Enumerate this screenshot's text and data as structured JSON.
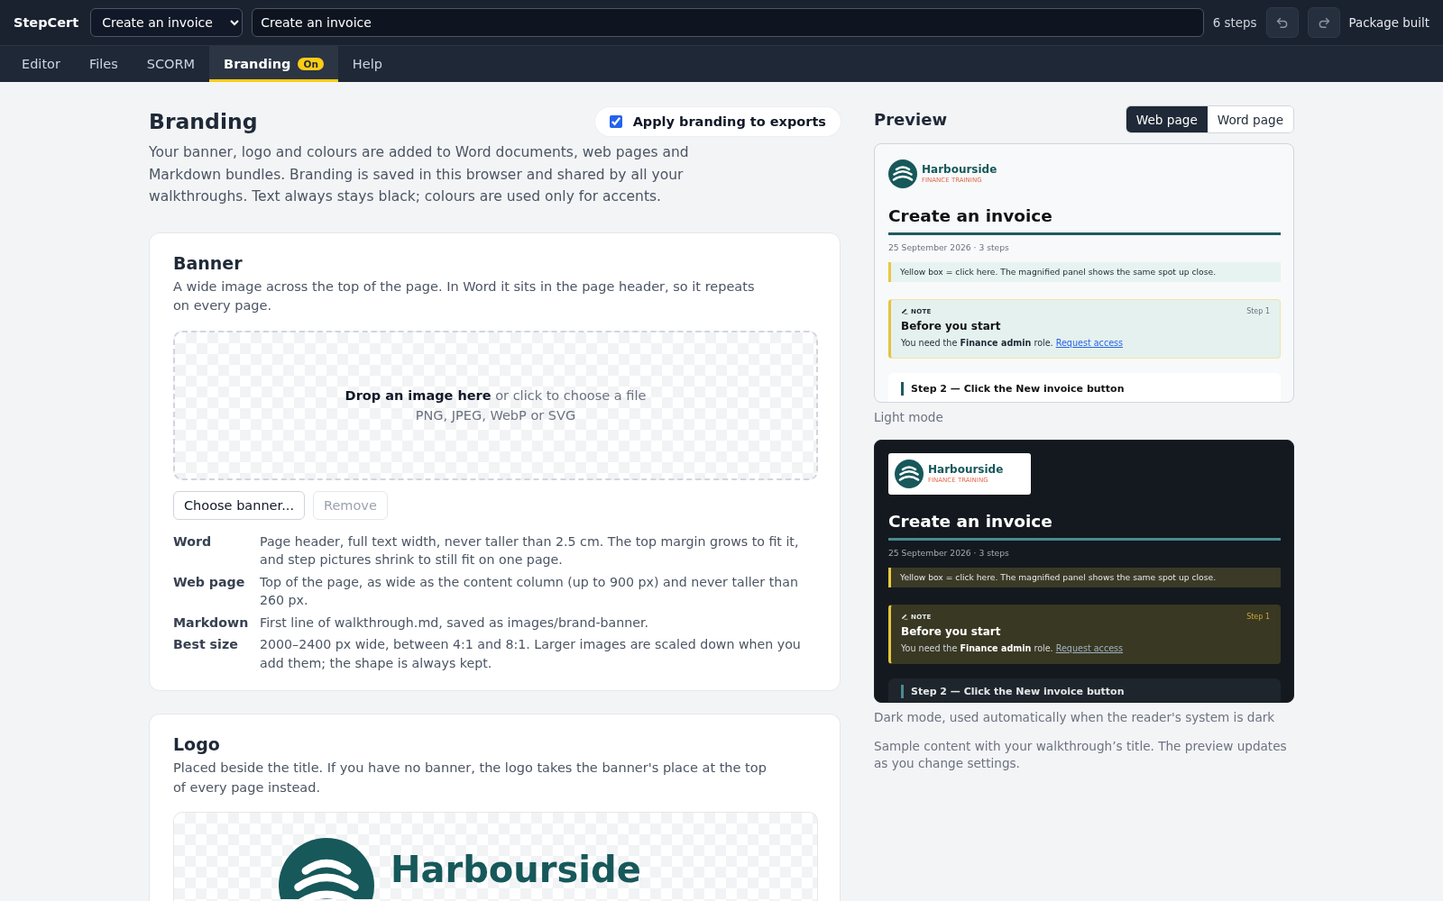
{
  "app": {
    "name": "StepCert"
  },
  "toolbar": {
    "walkthrough": "Create an invoice",
    "title": "Create an invoice",
    "step_count": "6 steps",
    "status": "Package built"
  },
  "tabs": [
    {
      "label": "Editor",
      "selected": false
    },
    {
      "label": "Files",
      "selected": false
    },
    {
      "label": "SCORM",
      "selected": false
    },
    {
      "label": "Branding",
      "selected": true,
      "badge": "On"
    },
    {
      "label": "Help",
      "selected": false
    }
  ],
  "branding": {
    "title": "Branding",
    "apply": {
      "label": "Apply branding to exports",
      "checked": true
    },
    "description": "Your banner, logo and colours are added to Word documents, web pages and Markdown bundles. Branding is saved in this browser and shared by all your walkthroughs. Text always stays black; colours are used only for accents."
  },
  "sections": [
    {
      "title": "Banner",
      "description": "A wide image across the top of the page. In Word it sits in the page header, so it repeats on every page.",
      "dropzone": {
        "prompt": "**Drop an image here** or click to choose a file",
        "formats": "PNG, JPEG, WebP or SVG"
      },
      "buttons": [
        {
          "label": "Choose banner...",
          "disabled": false
        },
        {
          "label": "Remove",
          "disabled": true
        }
      ],
      "details": [
        {
          "term": "Word",
          "text": "Page header, full text width, never taller than 2.5 cm. The top margin grows to fit it, and step pictures shrink to still fit on one page."
        },
        {
          "term": "Web page",
          "text": "Top of the page, as wide as the content column (up to 900 px) and never taller than 260 px."
        },
        {
          "term": "Markdown",
          "text": "First line of walkthrough.md, saved as images/brand-banner."
        },
        {
          "term": "Best size",
          "text": "2000–2400 px wide, between 4:1 and 8:1. Larger images are scaled down when you add them; the shape is always kept."
        }
      ]
    },
    {
      "title": "Logo",
      "description": "Placed beside the title. If you have no banner, the logo takes the banner's place at the top of every page instead.",
      "dropzone": {
        "logo": {
          "name": "Harbourside"
        }
      }
    }
  ],
  "preview": {
    "title": "Preview",
    "modes": [
      {
        "label": "Web page",
        "selected": true
      },
      {
        "label": "Word page",
        "selected": false
      }
    ],
    "samples": [
      {
        "kind": "light",
        "logo": {
          "name": "Harbourside",
          "tagline": "FINANCE TRAINING"
        },
        "title": "Create an invoice",
        "meta": "25 September 2026 · 3 steps",
        "hint": "Yellow box = click here. The magnified panel shows the same spot up close.",
        "note": {
          "label": "NOTE",
          "step": "Step 1",
          "title": "Before you start",
          "text": "You need the **Finance admin** role.",
          "link": "Request access"
        },
        "step": "Step 2 — Click the New invoice button",
        "caption": "Light mode"
      },
      {
        "kind": "dark",
        "logo": {
          "name": "Harbourside",
          "tagline": "FINANCE TRAINING"
        },
        "title": "Create an invoice",
        "meta": "25 September 2026 · 3 steps",
        "hint": "Yellow box = click here. The magnified panel shows the same spot up close.",
        "note": {
          "label": "NOTE",
          "step": "Step 1",
          "title": "Before you start",
          "text": "You need the **Finance admin** role.",
          "link": "Request access"
        },
        "step": "Step 2 — Click the New invoice button",
        "caption": "Dark mode, used automatically when the reader's system is dark"
      }
    ],
    "footnote": "Sample content with your walkthrough’s title. The preview updates as you change settings."
  }
}
